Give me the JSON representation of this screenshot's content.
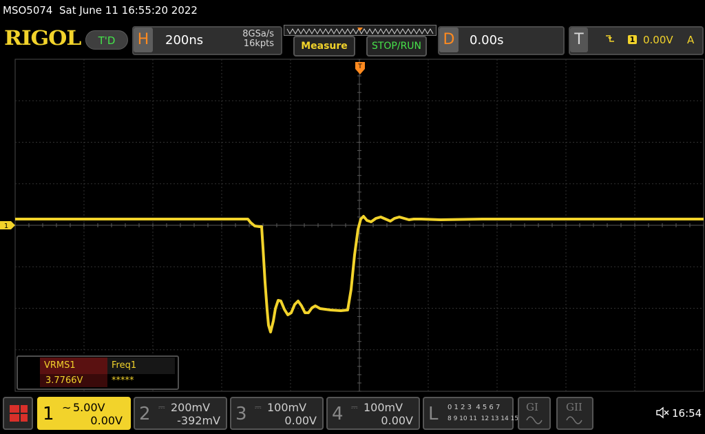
{
  "status_bar": {
    "model": "MSO5074",
    "datetime": "Sat June 11 16:55:20 2022"
  },
  "brand": {
    "logo": "RIGOL",
    "run_state": "T'D"
  },
  "horizontal": {
    "letter": "H",
    "timebase": "200ns",
    "sample_rate": "8GSa/s",
    "memory_depth": "16kpts"
  },
  "buttons": {
    "measure": "Measure",
    "stop_run": "STOP/RUN"
  },
  "delay": {
    "letter": "D",
    "value": "0.00s"
  },
  "trigger": {
    "letter": "T",
    "source": "1",
    "level": "0.00V",
    "mode": "A",
    "edge_icon": "falling-edge-icon"
  },
  "channel_marker": {
    "label": "1"
  },
  "measurements": {
    "headers": [
      "VRMS1",
      "Freq1"
    ],
    "values": [
      "3.7766V",
      "*****"
    ]
  },
  "channels": [
    {
      "number": "1",
      "coupling_icon": "ac-coupling-icon",
      "scale": "5.00V",
      "offset": "0.00V",
      "active": true
    },
    {
      "number": "2",
      "scale": "200mV",
      "offset": "-392mV",
      "active": false
    },
    {
      "number": "3",
      "scale": "100mV",
      "offset": "0.00V",
      "active": false
    },
    {
      "number": "4",
      "scale": "100mV",
      "offset": "0.00V",
      "active": false
    }
  ],
  "logic": {
    "letter": "L",
    "row1": "0 1 2 3  4 5 6 7",
    "row2": "8 9 10 11  12 13 14 15"
  },
  "generators": {
    "g1": "GI",
    "g2": "GII"
  },
  "system": {
    "clock": "16:54",
    "speaker_icon": "speaker-muted-icon"
  },
  "colors": {
    "ch1": "#f2d32b",
    "grid": "#3a3a3a",
    "accent_orange": "#ff8a1f",
    "green": "#47e24a"
  }
}
